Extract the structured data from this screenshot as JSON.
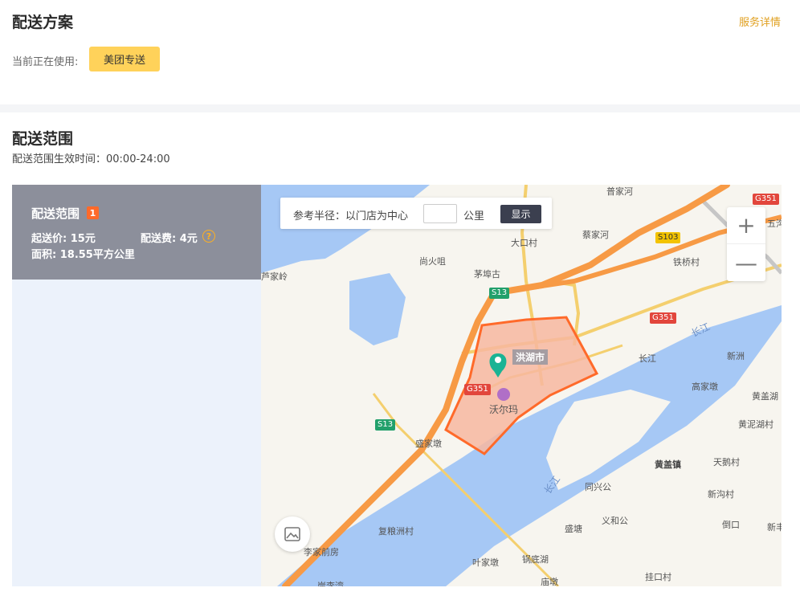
{
  "header": {
    "title": "配送方案",
    "service_link": "服务详情",
    "using_label": "当前正在使用:",
    "current_plan": "美团专送"
  },
  "range_section": {
    "title": "配送范围",
    "effective_time": "配送范围生效时间：00:00-24:00"
  },
  "side_panel": {
    "title": "配送范围",
    "index": "1",
    "min_price": "起送价: 15元",
    "delivery_fee": "配送费: 4元",
    "help_icon": "question-circle-icon",
    "area": "面积: 18.55平方公里"
  },
  "radius_tool": {
    "label": "参考半径：以门店为中心",
    "input_value": "",
    "unit": "公里",
    "button": "显示"
  },
  "zoom": {
    "in": "+",
    "out": "—"
  },
  "map": {
    "city": "洪湖市",
    "poi": "沃尔玛",
    "places": [
      "尚火咀",
      "茅埠古",
      "大口村",
      "蔡家河",
      "铁桥村",
      "长江",
      "新洲",
      "高家墩",
      "黄盖湖",
      "黄泥湖村",
      "黄盖镇",
      "天鹅村",
      "新沟村",
      "同兴公",
      "义和公",
      "盛塘",
      "倒口",
      "新丰",
      "锅底湖",
      "叶家墩",
      "复粮洲村",
      "李家前房",
      "盛家墩",
      "芦家岭",
      "庙墩",
      "挂口村",
      "五沟",
      "普家河",
      "岸李湾"
    ],
    "roads": [
      "G351",
      "S103",
      "S13",
      "G351",
      "G351",
      "S13",
      "S13"
    ],
    "rivers": [
      "长江",
      "长江"
    ],
    "colors": {
      "zone_fill": "#f7b7a0",
      "zone_stroke": "#ff6a2a",
      "water": "#a6c8f5",
      "land": "#f7f5ef",
      "highway": "#f79a45"
    }
  }
}
